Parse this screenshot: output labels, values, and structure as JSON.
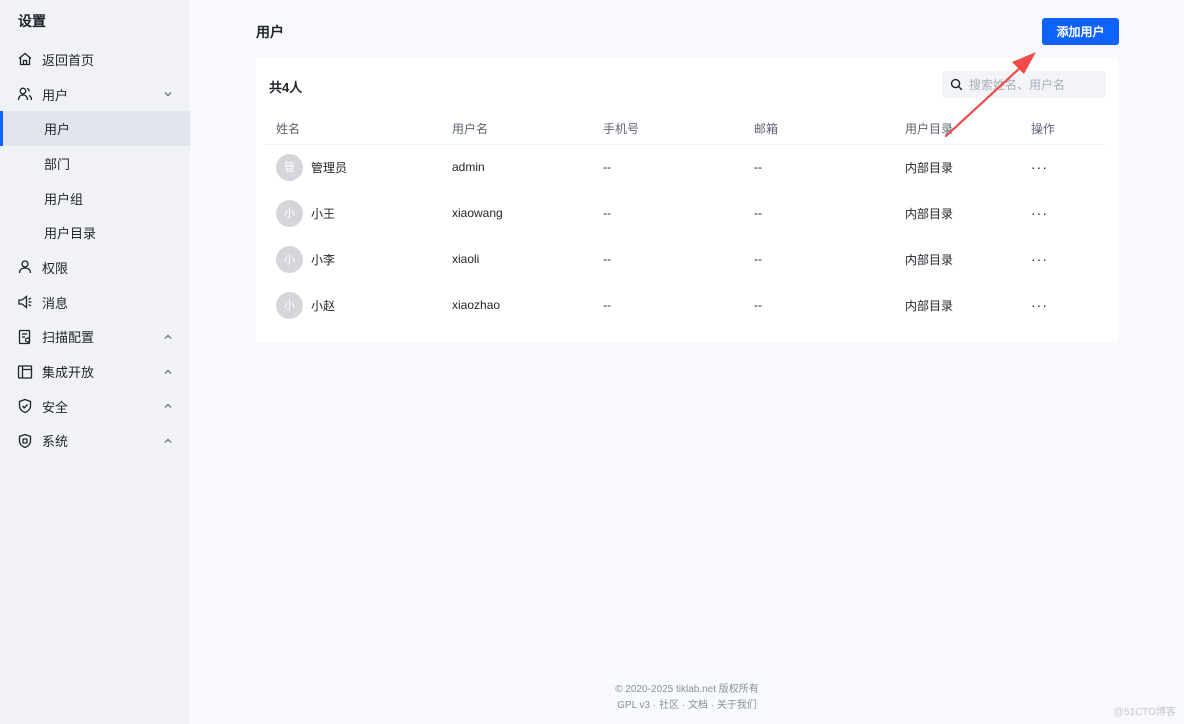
{
  "sidebar": {
    "title": "设置",
    "items": [
      {
        "label": "返回首页",
        "icon": "home-icon"
      },
      {
        "label": "用户",
        "icon": "users-icon",
        "expanded": true
      },
      {
        "label": "用户",
        "sub": true,
        "active": true
      },
      {
        "label": "部门",
        "sub": true
      },
      {
        "label": "用户组",
        "sub": true
      },
      {
        "label": "用户目录",
        "sub": true
      },
      {
        "label": "权限",
        "icon": "user-icon"
      },
      {
        "label": "消息",
        "icon": "speaker-icon"
      },
      {
        "label": "扫描配置",
        "icon": "document-icon"
      },
      {
        "label": "集成开放",
        "icon": "layout-icon"
      },
      {
        "label": "安全",
        "icon": "shield-icon"
      },
      {
        "label": "系统",
        "icon": "system-shield-icon"
      }
    ]
  },
  "header": {
    "title": "用户",
    "add_button": "添加用户"
  },
  "card": {
    "count_label": "共4人",
    "search_placeholder": "搜索姓名、用户名"
  },
  "table": {
    "columns": [
      "姓名",
      "用户名",
      "手机号",
      "邮箱",
      "用户目录",
      "操作"
    ],
    "rows": [
      {
        "avatar": "管",
        "name": "管理员",
        "username": "admin",
        "phone": "--",
        "email": "--",
        "directory": "内部目录",
        "action": "···"
      },
      {
        "avatar": "小",
        "name": "小王",
        "username": "xiaowang",
        "phone": "--",
        "email": "--",
        "directory": "内部目录",
        "action": "···"
      },
      {
        "avatar": "小",
        "name": "小李",
        "username": "xiaoli",
        "phone": "--",
        "email": "--",
        "directory": "内部目录",
        "action": "···"
      },
      {
        "avatar": "小",
        "name": "小赵",
        "username": "xiaozhao",
        "phone": "--",
        "email": "--",
        "directory": "内部目录",
        "action": "···"
      }
    ]
  },
  "footer": {
    "copyright": "© 2020-2025 tiklab.net 版权所有",
    "links": [
      "GPL v3",
      "社区",
      "文档",
      "关于我们"
    ],
    "separator": "·"
  },
  "watermark": "@51CTO博客",
  "colors": {
    "accent": "#0f62fe",
    "annotation_arrow": "#f24b4b"
  }
}
